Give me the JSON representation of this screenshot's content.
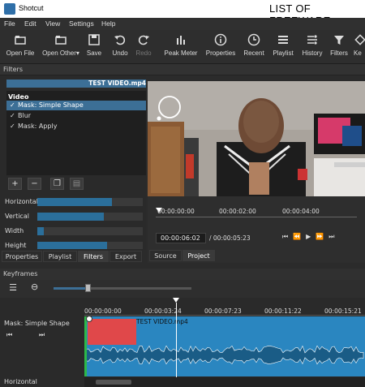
{
  "window": {
    "app_title": "Shotcut",
    "watermark": "LIST OF FREEWARE"
  },
  "menu": [
    "File",
    "Edit",
    "View",
    "Settings",
    "Help"
  ],
  "toolbar": {
    "open_file": "Open File",
    "open_other": "Open Other",
    "save": "Save",
    "undo": "Undo",
    "redo": "Redo",
    "peak_meter": "Peak Meter",
    "properties": "Properties",
    "recent": "Recent",
    "playlist": "Playlist",
    "history": "History",
    "filters": "Filters",
    "keyframes": "Ke"
  },
  "filters_panel": {
    "title": "Filters",
    "clip_name": "TEST VIDEO.mp4",
    "section": "Video",
    "items": [
      {
        "label": "Mask: Simple Shape",
        "checked": true,
        "selected": true
      },
      {
        "label": "Blur",
        "checked": true,
        "selected": false
      },
      {
        "label": "Mask: Apply",
        "checked": true,
        "selected": false
      }
    ],
    "params": [
      {
        "label": "Horizontal",
        "value": 0.71
      },
      {
        "label": "Vertical",
        "value": 0.63
      },
      {
        "label": "Width",
        "value": 0.06
      },
      {
        "label": "Height",
        "value": 0.66
      }
    ]
  },
  "left_tabs": [
    "Properties",
    "Playlist",
    "Filters",
    "Export"
  ],
  "player": {
    "ruler_labels": [
      "00:00:00:00",
      "00:00:02:00",
      "00:00:04:00"
    ],
    "current_time": "00:00:06:02",
    "total_time": "/ 00:00:05:23",
    "tabs": [
      "Source",
      "Project"
    ]
  },
  "keyframes": {
    "title": "Keyframes",
    "ruler_labels": [
      "00:00:00:00",
      "00:00:03:24",
      "00:00:07:23",
      "00:00:11:22",
      "00:00:15:21"
    ],
    "track_name": "Mask: Simple Shape",
    "clip_name": "TEST VIDEO.mp4",
    "param_label": "Horizontal",
    "zoom": 0.25
  },
  "colors": {
    "accent": "#3c6f96",
    "clip": "#2a86c0",
    "mask": "#e0484a"
  }
}
